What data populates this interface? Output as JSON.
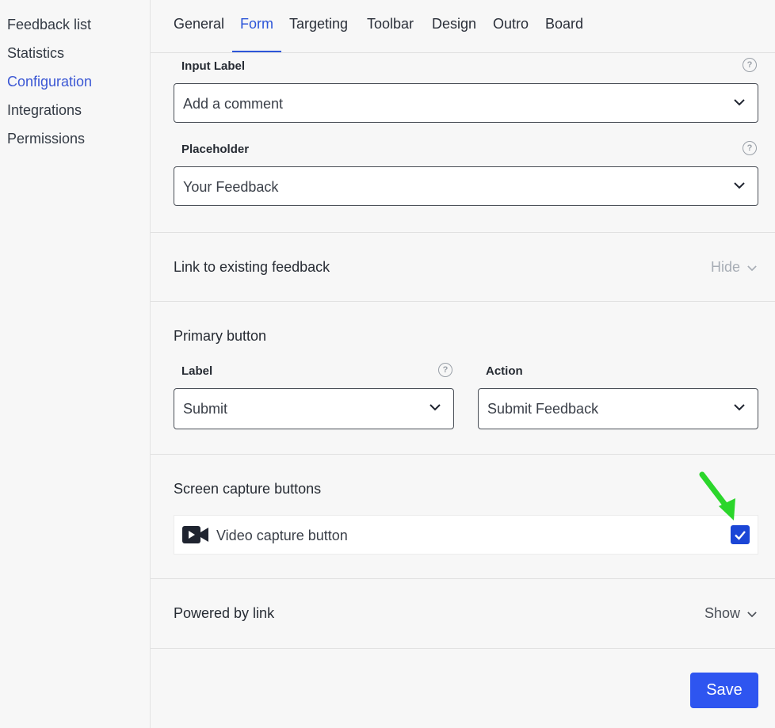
{
  "sidebar": {
    "items": [
      {
        "label": "Feedback list"
      },
      {
        "label": "Statistics"
      },
      {
        "label": "Configuration"
      },
      {
        "label": "Integrations"
      },
      {
        "label": "Permissions"
      }
    ],
    "active": "Configuration"
  },
  "tabs": {
    "items": [
      {
        "label": "General"
      },
      {
        "label": "Form"
      },
      {
        "label": "Targeting"
      },
      {
        "label": "Toolbar"
      },
      {
        "label": "Design"
      },
      {
        "label": "Outro"
      },
      {
        "label": "Board"
      }
    ],
    "active": "Form"
  },
  "input_label": {
    "label": "Input Label",
    "value": "Add a comment"
  },
  "placeholder": {
    "label": "Placeholder",
    "value": "Your Feedback"
  },
  "link_existing": {
    "title": "Link to existing feedback",
    "toggle": "Hide"
  },
  "primary_button": {
    "title": "Primary button",
    "label_field": {
      "label": "Label",
      "value": "Submit"
    },
    "action_field": {
      "label": "Action",
      "value": "Submit Feedback"
    }
  },
  "screen_capture": {
    "title": "Screen capture buttons",
    "video": {
      "label": "Video capture button",
      "checked": true
    }
  },
  "powered_by": {
    "title": "Powered by link",
    "toggle": "Show"
  },
  "save_label": "Save",
  "colors": {
    "accent": "#2d56d8",
    "save": "#2e55f0",
    "checkbox": "#1b46d6",
    "annotation_arrow": "#2bd62b"
  },
  "icons": {
    "help": "question-circle-icon",
    "video": "video-camera-icon",
    "chevron": "chevron-down-icon",
    "check": "check-icon"
  }
}
